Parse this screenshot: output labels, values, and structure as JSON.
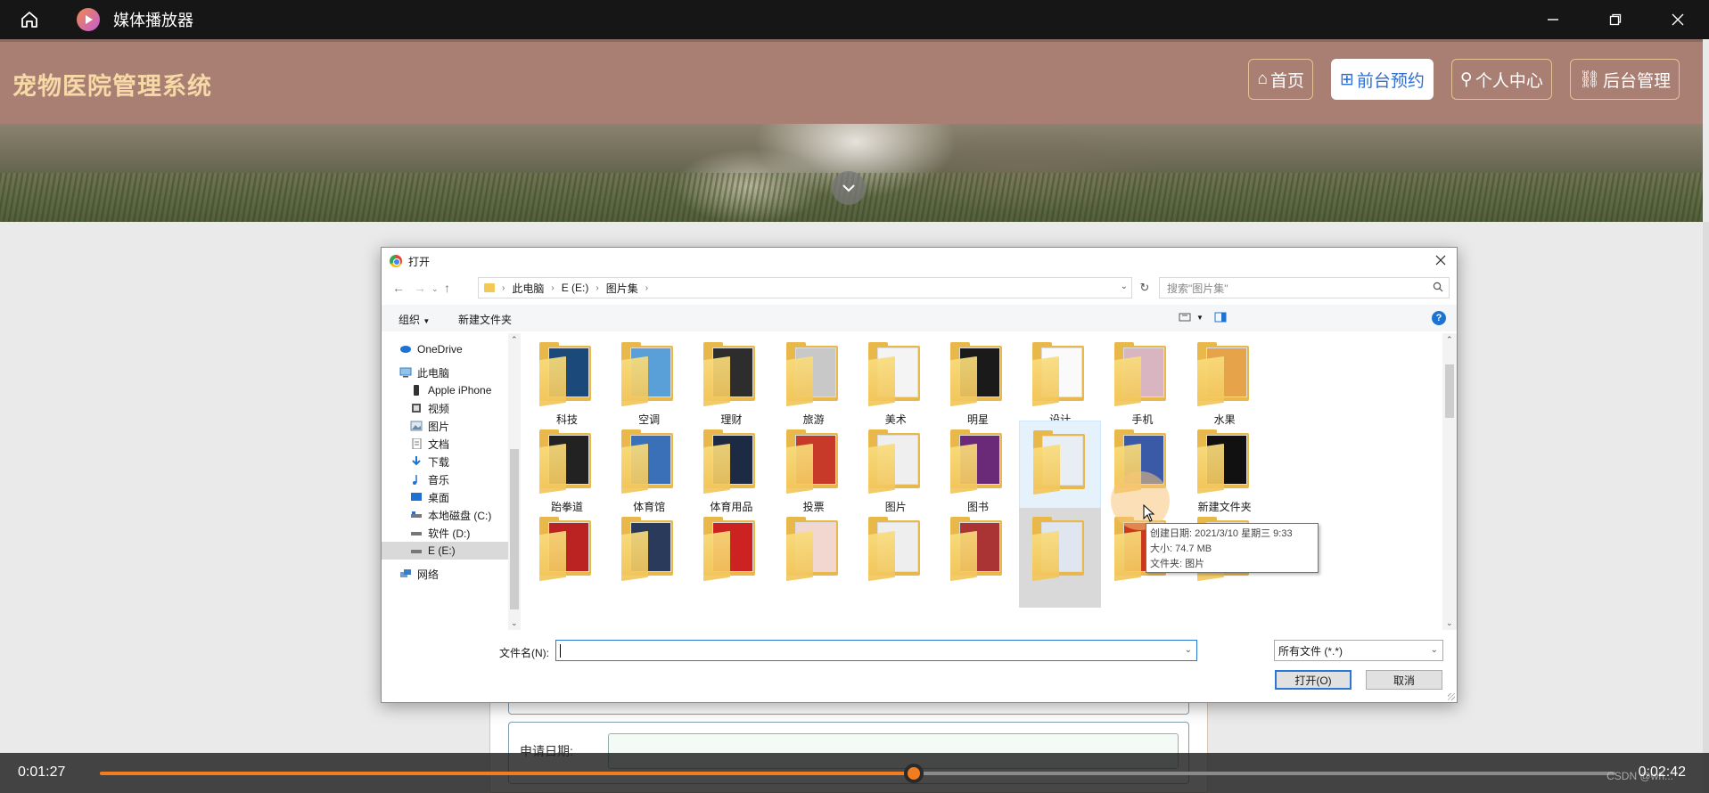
{
  "player": {
    "title": "媒体播放器",
    "current_time": "0:01:27",
    "total_time": "0:02:42",
    "progress": 0.537,
    "watermark": "CSDN @wh..."
  },
  "site": {
    "title": "宠物医院管理系统",
    "nav": [
      {
        "label": "首页",
        "icon": "home-icon"
      },
      {
        "label": "前台预约",
        "icon": "grid-icon",
        "active": true
      },
      {
        "label": "个人中心",
        "icon": "user-icon"
      },
      {
        "label": "后台管理",
        "icon": "link-icon"
      }
    ],
    "accent": "#a97f73"
  },
  "form": {
    "date_label": "申请日期:"
  },
  "dialog": {
    "title": "打开",
    "breadcrumbs": [
      "此电脑",
      "E (E:)",
      "图片集"
    ],
    "search_placeholder": "搜索\"图片集\"",
    "toolbar": {
      "organize": "组织",
      "new_folder": "新建文件夹"
    },
    "nav_items": [
      {
        "label": "OneDrive",
        "icon": "cloud-icon"
      },
      {
        "label": "此电脑",
        "icon": "computer-icon"
      },
      {
        "label": "Apple iPhone",
        "icon": "phone-icon"
      },
      {
        "label": "视频",
        "icon": "video-icon"
      },
      {
        "label": "图片",
        "icon": "picture-icon"
      },
      {
        "label": "文档",
        "icon": "document-icon"
      },
      {
        "label": "下载",
        "icon": "download-icon"
      },
      {
        "label": "音乐",
        "icon": "music-icon"
      },
      {
        "label": "桌面",
        "icon": "desktop-icon"
      },
      {
        "label": "本地磁盘 (C:)",
        "icon": "drive-icon"
      },
      {
        "label": "软件 (D:)",
        "icon": "drive-icon"
      },
      {
        "label": "E (E:)",
        "icon": "drive-icon",
        "selected": true
      },
      {
        "label": "网络",
        "icon": "network-icon"
      }
    ],
    "folders_row1": [
      "科技",
      "空调",
      "理财",
      "旅游",
      "美术",
      "明星",
      "设计",
      "手机",
      "水果"
    ],
    "folders_row2": [
      "跆拳道",
      "体育馆",
      "体育用品",
      "投票",
      "图片",
      "图书",
      "",
      "",
      "新建文件夹"
    ],
    "folders_row3": [
      "",
      "",
      "",
      "",
      "",
      "",
      "",
      "",
      ""
    ],
    "tooltip": {
      "line1": "创建日期: 2021/3/10 星期三 9:33",
      "line2": "大小: 74.7 MB",
      "line3": "文件夹: 图片"
    },
    "filename_label": "文件名(N):",
    "filename_value": "",
    "file_type": "所有文件 (*.*)",
    "open_label": "打开(O)",
    "cancel_label": "取消"
  }
}
